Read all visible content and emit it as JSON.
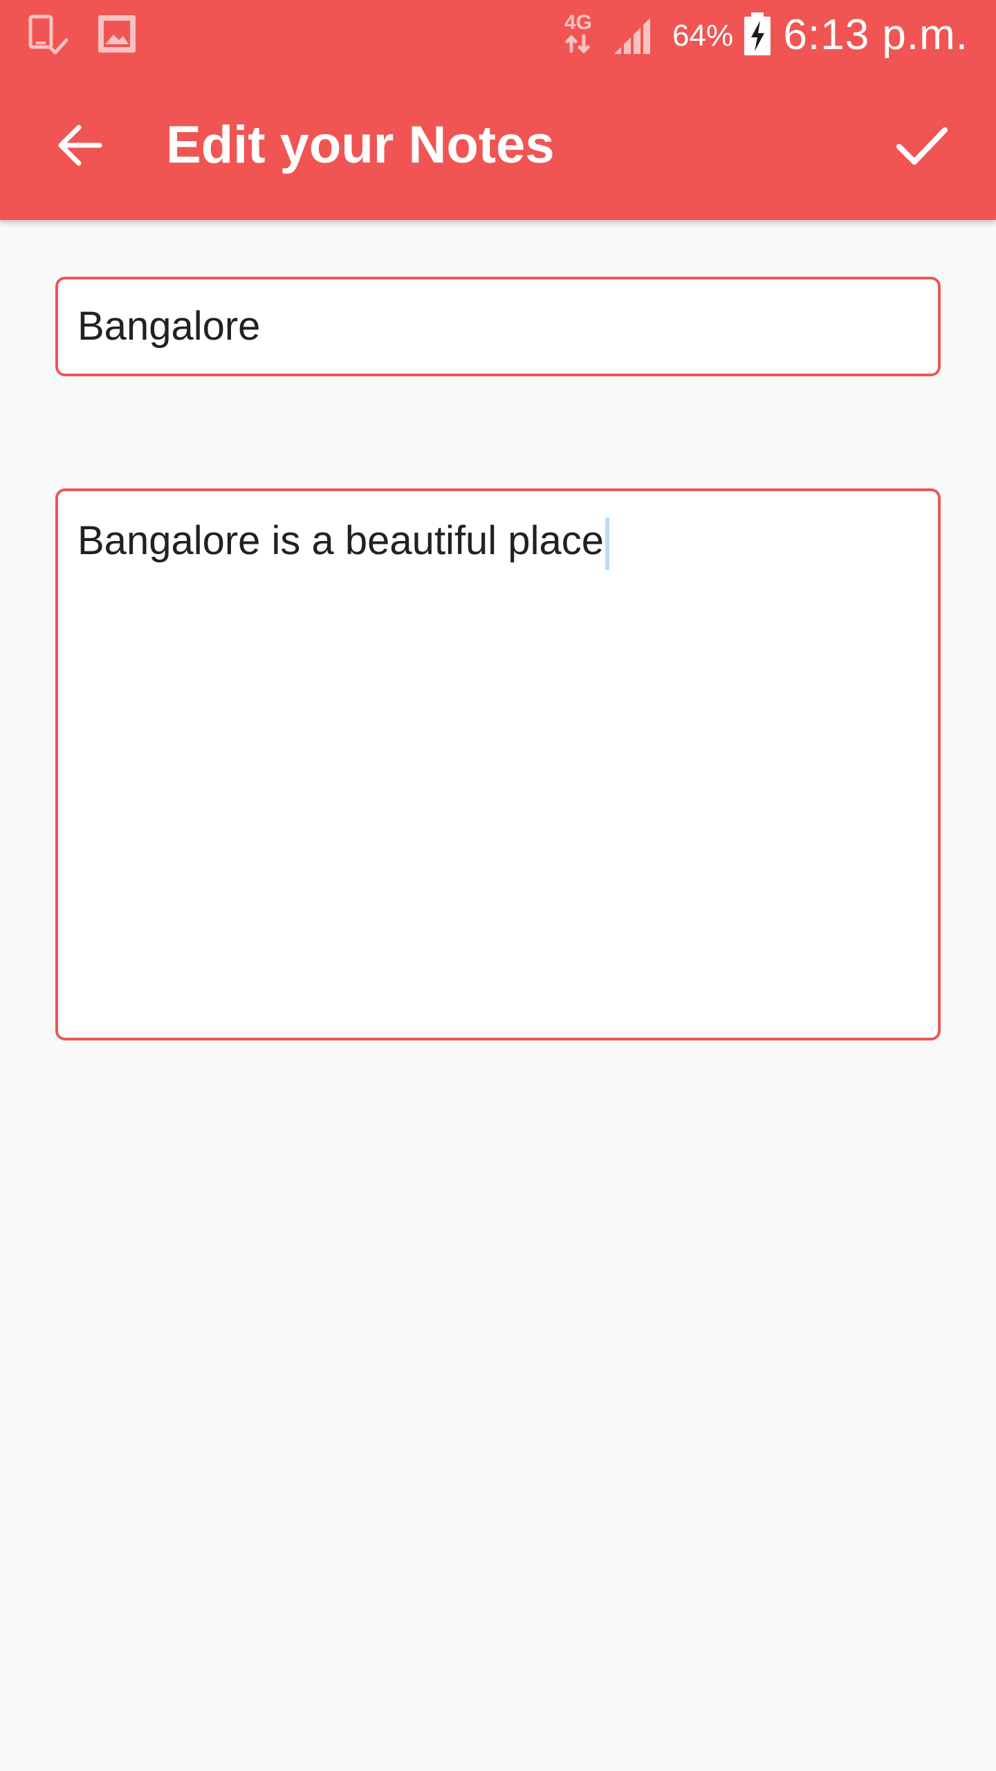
{
  "status_bar": {
    "notification_icons": [
      "device-check-icon",
      "image-icon"
    ],
    "network_label": "4G",
    "battery_percent": "64%",
    "time": "6:13 p.m.",
    "colors": {
      "background": "#f05554",
      "foreground": "#ffffff"
    }
  },
  "app_bar": {
    "title": "Edit your Notes",
    "back_icon": "arrow-back-icon",
    "save_icon": "check-icon",
    "colors": {
      "background": "#f05554",
      "foreground": "#ffffff"
    }
  },
  "form": {
    "title_value": "Bangalore",
    "body_value": "Bangalore is a beautiful place",
    "colors": {
      "field_border": "#e8585a",
      "text": "#212121",
      "caret": "#bcdcf6",
      "page_background": "#f9f9f9"
    }
  }
}
